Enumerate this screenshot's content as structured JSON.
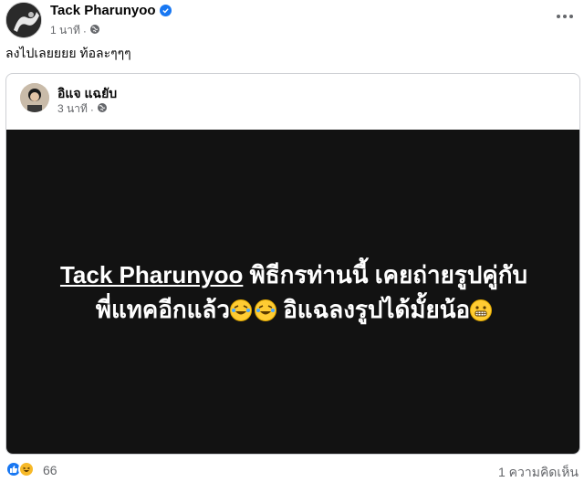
{
  "post": {
    "author": "Tack Pharunyoo",
    "time": "1 นาที",
    "dot": "·",
    "caption": "ลงไปเลยยยย ท้อละๆๆๆ"
  },
  "shared": {
    "author": "อิแจ แฉยับ",
    "time": "3 นาที",
    "dot": "·",
    "line1_tag": "Tack Pharunyoo",
    "line1_rest": " พิธีกรท่านนี้ เคยถ่ายรูปคู่กับ",
    "line2_a": "พี่แทคอีกแล้ว",
    "line2_b": " อิแฉลงรูปได้มั้ยน้อ"
  },
  "footer": {
    "reaction_count": "66",
    "comments": "1 ความคิดเห็น"
  },
  "colors": {
    "brand": "#1877f2",
    "secondary_text": "#65676b",
    "image_bg": "#121212"
  },
  "icons": [
    "verified-badge-icon",
    "public-globe-icon",
    "more-options-icon",
    "rofl-emoji-icon",
    "grimacing-emoji-icon",
    "like-reaction-icon",
    "haha-reaction-icon"
  ]
}
